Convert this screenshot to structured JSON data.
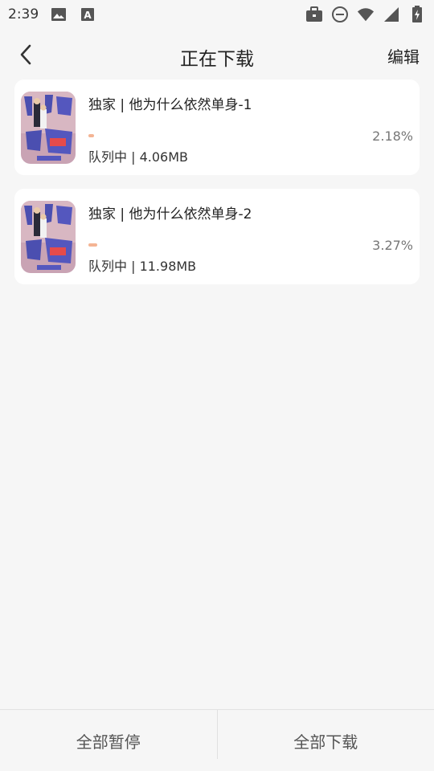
{
  "status_bar": {
    "time": "2:39",
    "icons": [
      "image-icon",
      "font-a-icon",
      "briefcase-icon",
      "do-not-disturb-icon",
      "wifi-icon",
      "signal-icon",
      "battery-charging-icon"
    ]
  },
  "header": {
    "title": "正在下载",
    "edit_label": "编辑",
    "back_icon": "chevron-left-icon"
  },
  "downloads": [
    {
      "title": "独家 | 他为什么依然单身-1",
      "status": "队列中 | 4.06MB",
      "percent_text": "2.18%",
      "progress": 0.0218
    },
    {
      "title": "独家 | 他为什么依然单身-2",
      "status": "队列中 | 11.98MB",
      "percent_text": "3.27%",
      "progress": 0.0327
    }
  ],
  "bottom_bar": {
    "pause_all_label": "全部暂停",
    "download_all_label": "全部下载"
  },
  "colors": {
    "progress": "#f4b494",
    "background": "#f6f6f6",
    "card": "#ffffff"
  }
}
